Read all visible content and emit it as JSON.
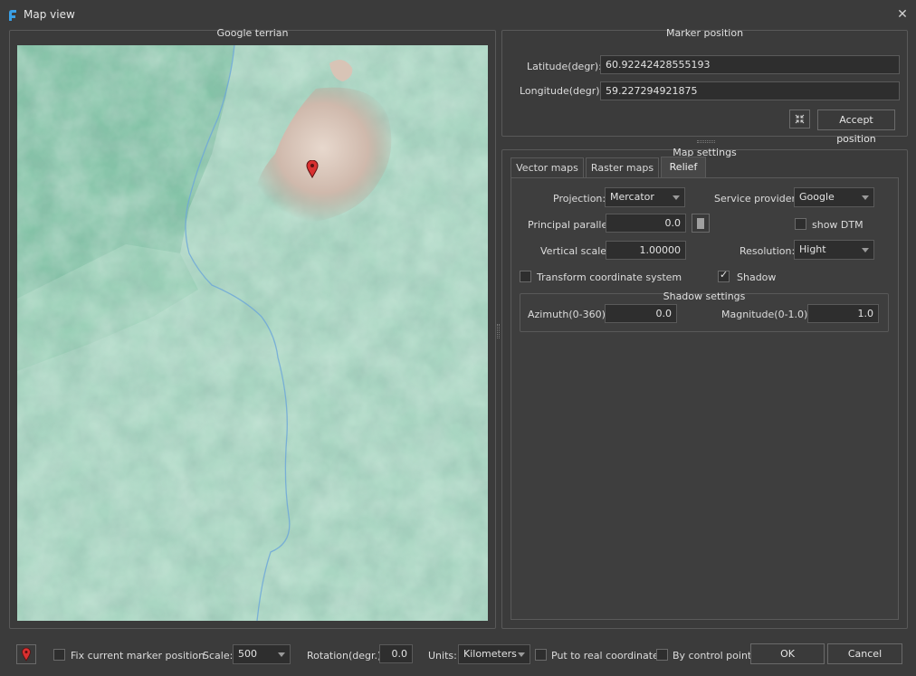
{
  "window": {
    "title": "Map view",
    "close_icon": "close-icon"
  },
  "map": {
    "title": "Google terrian",
    "marker_icon": "map-pin-icon",
    "marker_color": "#d93030"
  },
  "marker_position": {
    "title": "Marker position",
    "latitude_label": "Latitude(degr):",
    "latitude_value": "60.92242428555193",
    "longitude_label": "Longitude(degr):",
    "longitude_value": "59.227294921875",
    "center_icon": "collapse-arrows-icon",
    "accept_label": "Accept position"
  },
  "map_settings": {
    "title": "Map settings",
    "tabs": [
      {
        "label": "Vector maps",
        "active": false
      },
      {
        "label": "Raster maps",
        "active": false
      },
      {
        "label": "Relief",
        "active": true
      }
    ],
    "relief": {
      "projection_label": "Projection:",
      "projection_value": "Mercator",
      "service_label": "Service provider:",
      "service_value": "Google",
      "principal_label": "Principal parallel:",
      "principal_value": "0.0",
      "show_dtm_label": "show DTM",
      "show_dtm_checked": false,
      "vertical_label": "Vertical scale:",
      "vertical_value": "1.00000",
      "resolution_label": "Resolution:",
      "resolution_value": "Hight",
      "transform_label": "Transform coordinate system",
      "transform_checked": false,
      "shadow_label": "Shadow",
      "shadow_checked": true,
      "shadow_settings": {
        "title": "Shadow settings",
        "azimuth_label": "Azimuth(0-360):",
        "azimuth_value": "0.0",
        "magnitude_label": "Magnitude(0-1.0):",
        "magnitude_value": "1.0"
      }
    }
  },
  "bottom": {
    "marker_icon": "map-pin-icon",
    "fix_label": "Fix current marker position",
    "fix_checked": false,
    "scale_label": "Scale:",
    "scale_value": "500",
    "rotation_label": "Rotation(degr.)",
    "rotation_value": "0.0",
    "units_label": "Units:",
    "units_value": "Kilometers",
    "real_coords_label": "Put to real coordinates",
    "real_coords_checked": false,
    "control_points_label": "By control points",
    "control_points_checked": false,
    "ok_label": "OK",
    "cancel_label": "Cancel"
  }
}
